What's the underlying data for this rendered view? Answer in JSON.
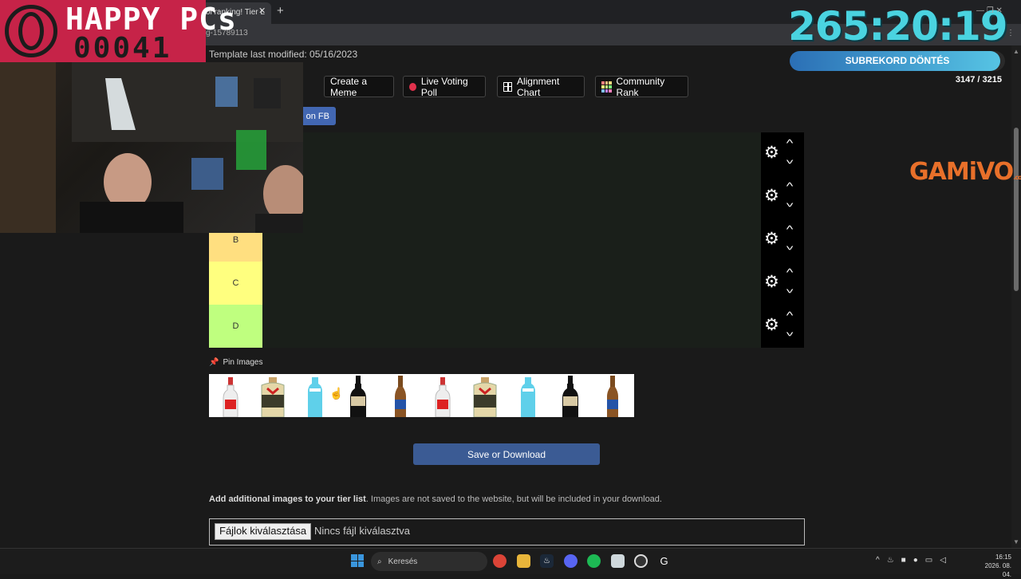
{
  "browser": {
    "tab_title": "ol ranking! Tier L",
    "tab_close": "✕",
    "new_tab": "+",
    "url": "g-15789113"
  },
  "page": {
    "modified": "Template last modified: 05/16/2023",
    "buttons": {
      "meme": "Create a Meme",
      "vote": "Live Voting Poll",
      "align": "Alignment Chart",
      "rank": "Community Rank",
      "fb": "e on FB"
    },
    "tiers": [
      {
        "label": "",
        "color": "#ff7f7f"
      },
      {
        "label": "",
        "color": "#ffbf7f"
      },
      {
        "label": "B",
        "color": "#ffdf80"
      },
      {
        "label": "C",
        "color": "#ffff7f"
      },
      {
        "label": "D",
        "color": "#bfff7f"
      }
    ],
    "pin_label": "Pin Images",
    "images": [
      "vodka-bottle",
      "cream-liqueur-bottle",
      "blue-liqueur-bottle",
      "baileys-bottle",
      "bud-light-bottle",
      "vodka-bottle",
      "cream-liqueur-bottle",
      "blue-liqueur-bottle",
      "baileys-bottle",
      "bud-light-bottle"
    ],
    "save_label": "Save or Download",
    "add_info_bold": "Add additional images to your tier list",
    "add_info_rest": ". Images are not saved to the website, but will be included in your download.",
    "file_button": "Fájlok kiválasztása",
    "file_none": "Nincs fájl kiválasztva"
  },
  "overlay": {
    "brand": "HAPPY PCs",
    "brand_count": "00041",
    "timer": "265:20:19",
    "sub_label": "SUBREKORD DÖNTÉS",
    "sub_count": "3147 / 3215",
    "sub_progress": 0.979,
    "sponsor": "GAMiVO",
    "sponsor_suffix": ".com"
  },
  "taskbar": {
    "search": "Keresés",
    "time": "16:15",
    "date": "2026. 08. 04."
  },
  "colors": {
    "accent": "#c62348",
    "timer": "#4ad3e0",
    "save": "#3b5b94"
  }
}
